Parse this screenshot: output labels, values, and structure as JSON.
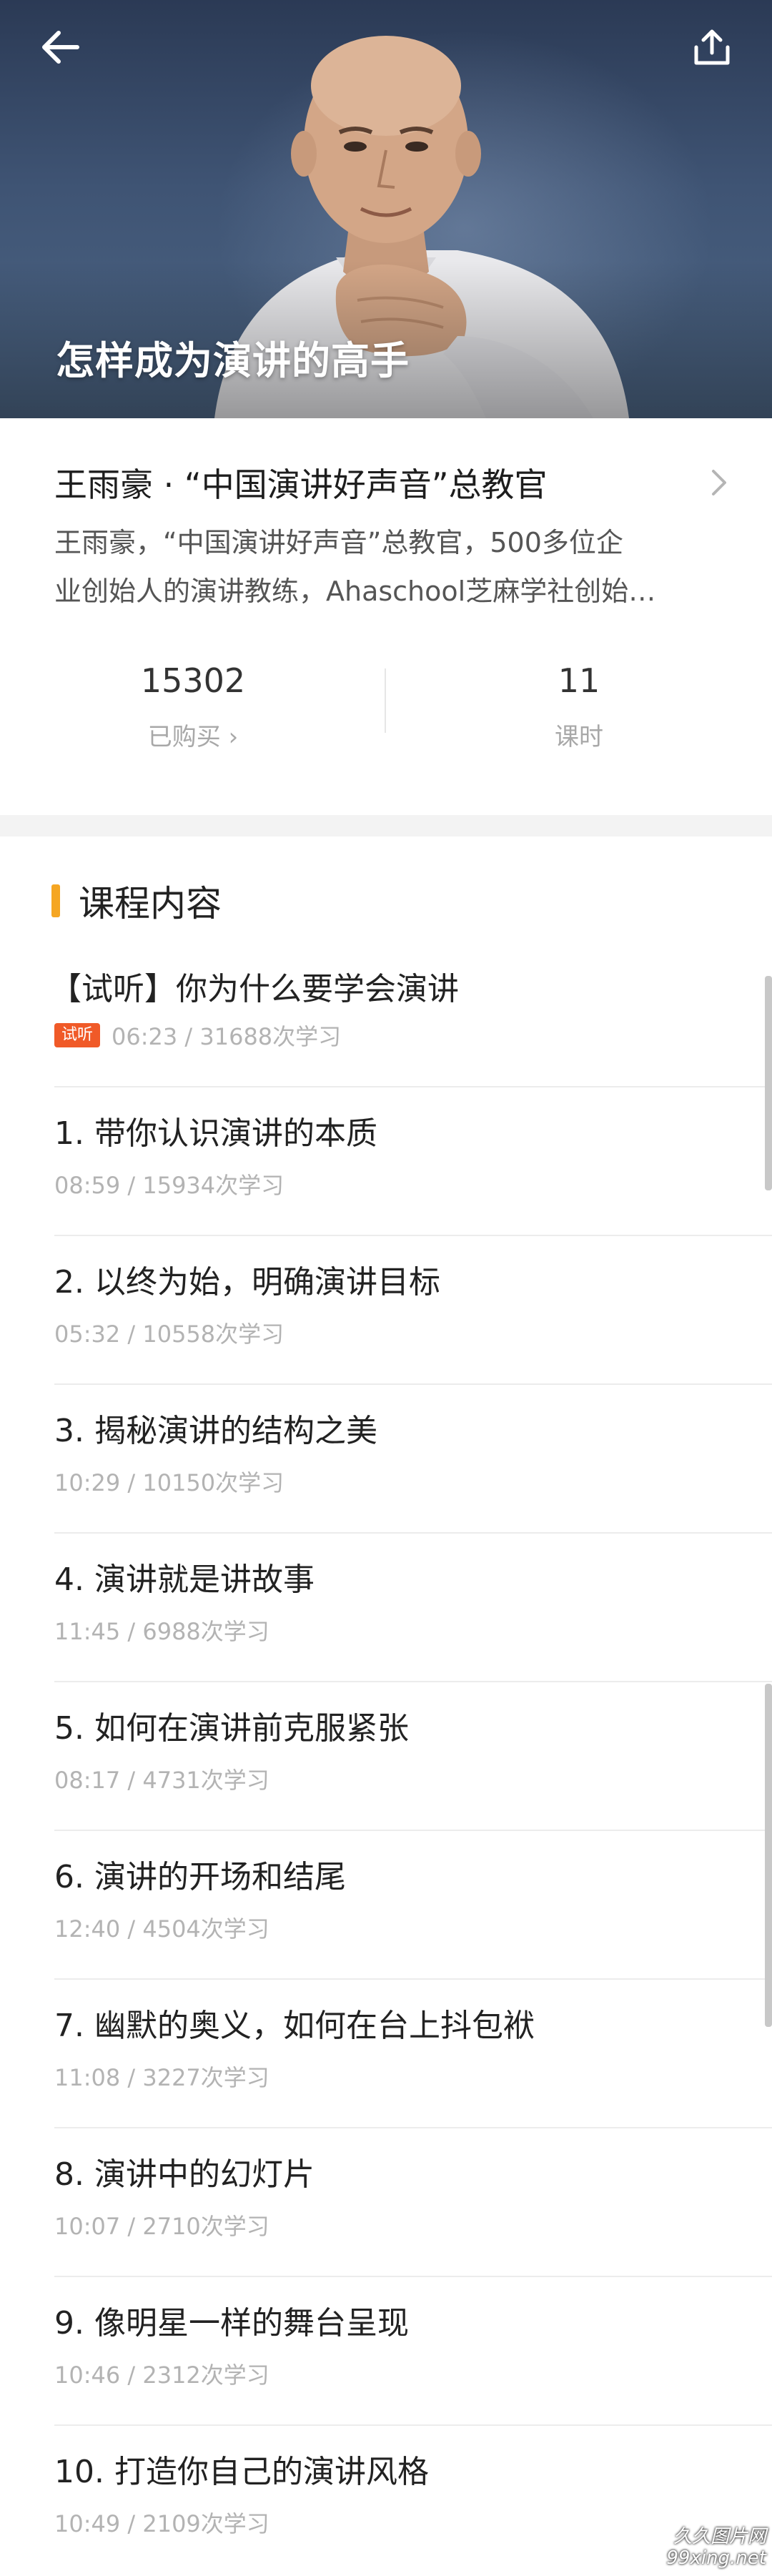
{
  "hero": {
    "title": "怎样成为演讲的高手"
  },
  "author": {
    "name": "王雨豪 · “中国演讲好声音”总教官",
    "desc_line1": "王雨豪，“中国演讲好声音”总教官，500多位企",
    "desc_line2": "业创始人的演讲教练，Ahaschool芝麻学社创始…"
  },
  "stats": {
    "purchased_count": "15302",
    "purchased_label": "已购买 ›",
    "lessons_count": "11",
    "lessons_label": "课时"
  },
  "course": {
    "heading": "课程内容",
    "accent_color": "#f5a623",
    "items": [
      {
        "title": "【试听】你为什么要学会演讲",
        "badge": "试听",
        "meta": "06:23 / 31688次学习"
      },
      {
        "title": "1. 带你认识演讲的本质",
        "meta": "08:59 / 15934次学习"
      },
      {
        "title": "2. 以终为始，明确演讲目标",
        "meta": "05:32 / 10558次学习"
      },
      {
        "title": "3. 揭秘演讲的结构之美",
        "meta": "10:29 / 10150次学习"
      },
      {
        "title": "4. 演讲就是讲故事",
        "meta": "11:45 / 6988次学习"
      },
      {
        "title": "5. 如何在演讲前克服紧张",
        "meta": "08:17 / 4731次学习"
      },
      {
        "title": "6. 演讲的开场和结尾",
        "meta": "12:40 / 4504次学习"
      },
      {
        "title": "7. 幽默的奥义，如何在台上抖包袱",
        "meta": "11:08 / 3227次学习"
      },
      {
        "title": "8. 演讲中的幻灯片",
        "meta": "10:07 / 2710次学习"
      },
      {
        "title": "9. 像明星一样的舞台呈现",
        "meta": "10:46 / 2312次学习"
      },
      {
        "title": "10. 打造你自己的演讲风格",
        "meta": "10:49 / 2109次学习"
      }
    ]
  },
  "icons": {
    "back": "arrow-left-icon",
    "share": "share-icon",
    "chevron": "chevron-right-icon"
  },
  "watermark": {
    "line1": "久久图片网",
    "line2": "99xing.net"
  }
}
